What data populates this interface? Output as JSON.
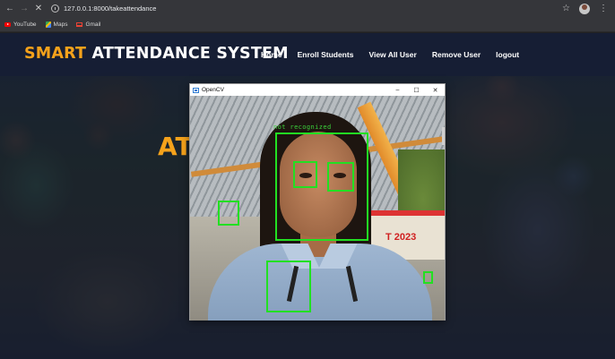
{
  "browser": {
    "url": "127.0.0.1:8000/takeattendance",
    "bookmarks": [
      {
        "label": "YouTube",
        "icon": "youtube-icon"
      },
      {
        "label": "Maps",
        "icon": "maps-icon"
      },
      {
        "label": "Gmail",
        "icon": "gmail-icon"
      }
    ]
  },
  "site": {
    "brand_accent": "SMART",
    "brand_rest": "ATTENDANCE SYSTEM",
    "nav": [
      "Home",
      "Enroll Students",
      "View All User",
      "Remove User",
      "logout"
    ],
    "hero_partial": "AT",
    "accent_color": "#f5a21b"
  },
  "opencv_window": {
    "title": "OpenCV",
    "controls": {
      "minimize": "–",
      "maximize": "☐",
      "close": "✕"
    },
    "detection_label": "not recognized",
    "background_banner_text": "T 2023",
    "box_color": "#22e022"
  }
}
